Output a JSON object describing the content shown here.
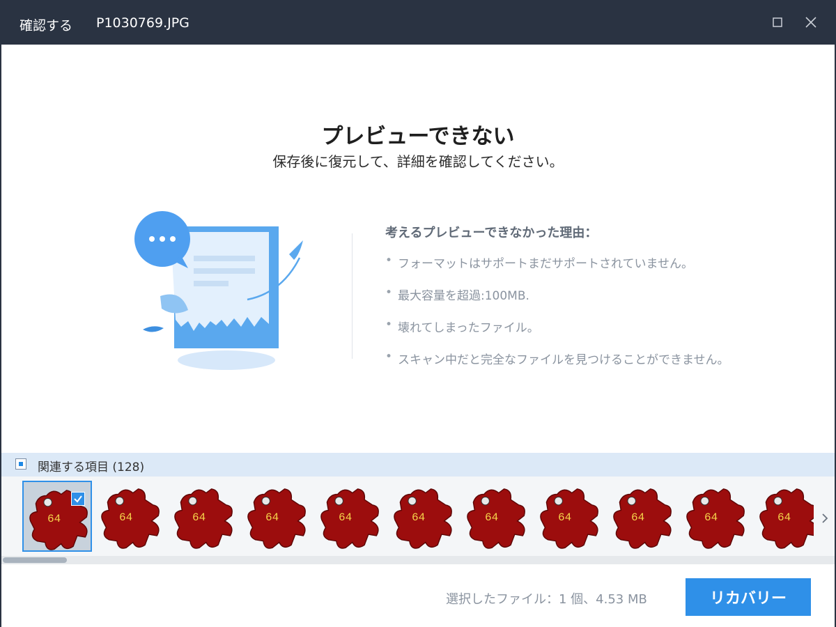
{
  "window": {
    "title": "確認する",
    "filename": "P1030769.JPG"
  },
  "preview": {
    "heading": "プレビューできない",
    "subheading": "保存後に復元して、詳細を確認してください。"
  },
  "reasons": {
    "title": "考えるプレビューできなかった理由：",
    "items": [
      "フォーマットはサポートまだサポートされていません。",
      "最大容量を超過:100MB.",
      "壊れてしまったファイル。",
      "スキャン中だと完全なファイルを見つけることができません。"
    ]
  },
  "related": {
    "label": "関連する項目 (128)"
  },
  "thumbnails": {
    "badge": "64",
    "count_visible": 11,
    "selected_index": 0
  },
  "footer": {
    "selected_info": "選択したファイル：1 個、4.53 MB",
    "recover_label": "リカバリー"
  },
  "colors": {
    "titlebar": "#2a3342",
    "accent": "#2f90e8",
    "related_bar": "#dce9f7",
    "thumb_red": "#9c0d0d"
  }
}
